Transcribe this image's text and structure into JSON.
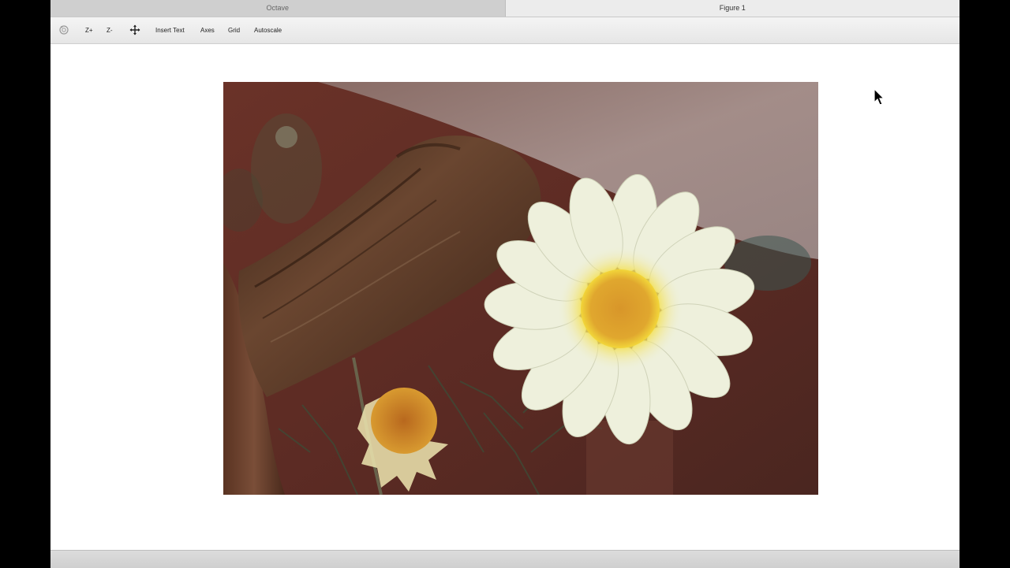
{
  "tabs": [
    {
      "label": "Octave",
      "active": false
    },
    {
      "label": "Figure 1",
      "active": true
    }
  ],
  "toolbar": {
    "rotate_icon": "rotate-icon",
    "zoom_in_label": "Z+",
    "zoom_out_label": "Z-",
    "pan_icon": "pan-move-icon",
    "insert_text_label": "Insert Text",
    "axes_label": "Axes",
    "grid_label": "Grid",
    "autoscale_label": "Autoscale"
  },
  "figure": {
    "image_subject": "white daisy flower with yellow center beside weathered wooden branch",
    "colors": {
      "background": "#5e2e26",
      "petal": "#eef0dc",
      "center": "#e0a72e",
      "center_ring": "#f2d63a",
      "wood": "#5a3a28",
      "foliage": "#4d5a40"
    }
  },
  "colors": {
    "window_bg": "#ffffff",
    "toolbar_bg": "#ececec",
    "tab_inactive": "#cfcfcf",
    "outer_bg": "#000000"
  }
}
